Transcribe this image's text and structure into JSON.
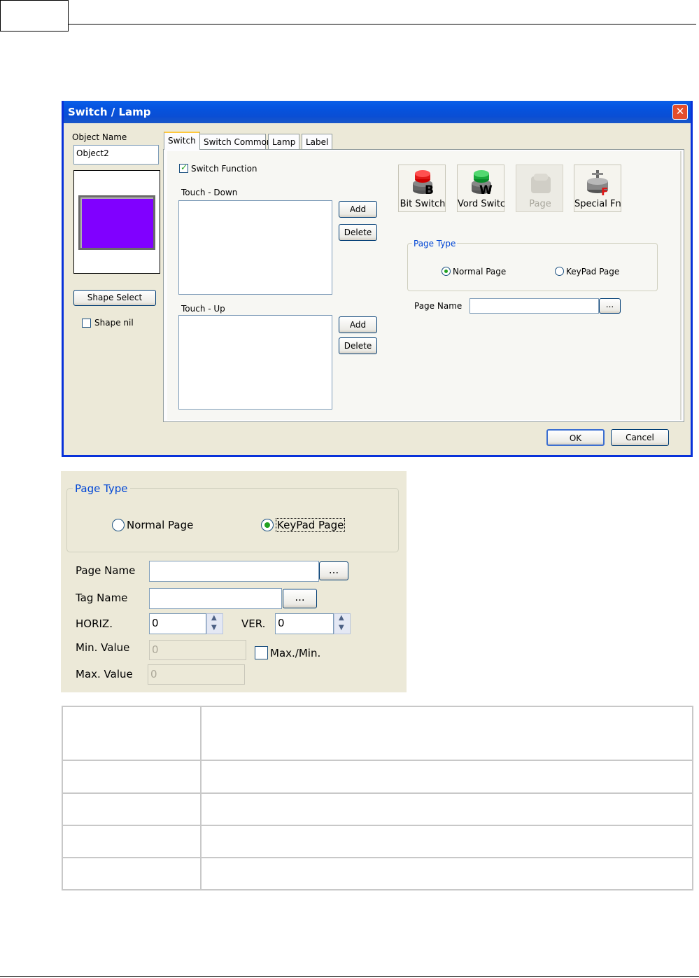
{
  "dialog": {
    "title": "Switch / Lamp",
    "close_glyph": "✕",
    "object_name_label": "Object Name",
    "object_name_value": "Object2",
    "preview_color": "#8000ff",
    "shape_select": "Shape Select",
    "shape_nil": "Shape nil",
    "tabs": [
      "Switch",
      "Switch Common",
      "Lamp",
      "Label"
    ],
    "switch_function": "Switch Function",
    "touch_down": "Touch - Down",
    "touch_up": "Touch - Up",
    "add": "Add",
    "delete": "Delete",
    "icon_buttons": [
      {
        "label": "Bit Switch",
        "icon": "bit-switch-icon"
      },
      {
        "label": "Vord Switcl",
        "icon": "word-switch-icon"
      },
      {
        "label": "Page",
        "icon": "page-icon"
      },
      {
        "label": "Special Fn.",
        "icon": "special-fn-icon"
      }
    ],
    "page_type_legend": "Page Type",
    "normal_page": "Normal Page",
    "keypad_page": "KeyPad Page",
    "page_name": "Page Name",
    "browse": "...",
    "ok": "OK",
    "cancel": "Cancel"
  },
  "zoom": {
    "page_type_legend": "Page Type",
    "normal_page": "Normal Page",
    "keypad_page": "KeyPad Page",
    "page_name": "Page Name",
    "tag_name": "Tag Name",
    "browse": "...",
    "horiz": "HORIZ.",
    "horiz_value": "0",
    "ver": "VER.",
    "ver_value": "0",
    "min_value": "Min. Value",
    "min_value_value": "0",
    "max_min": "Max./Min.",
    "max_value": "Max. Value",
    "max_value_value": "0"
  },
  "colors": {
    "title_bar": "#0554e0",
    "dialog_bg": "#ece9d8",
    "legend_text": "#0046d5"
  }
}
